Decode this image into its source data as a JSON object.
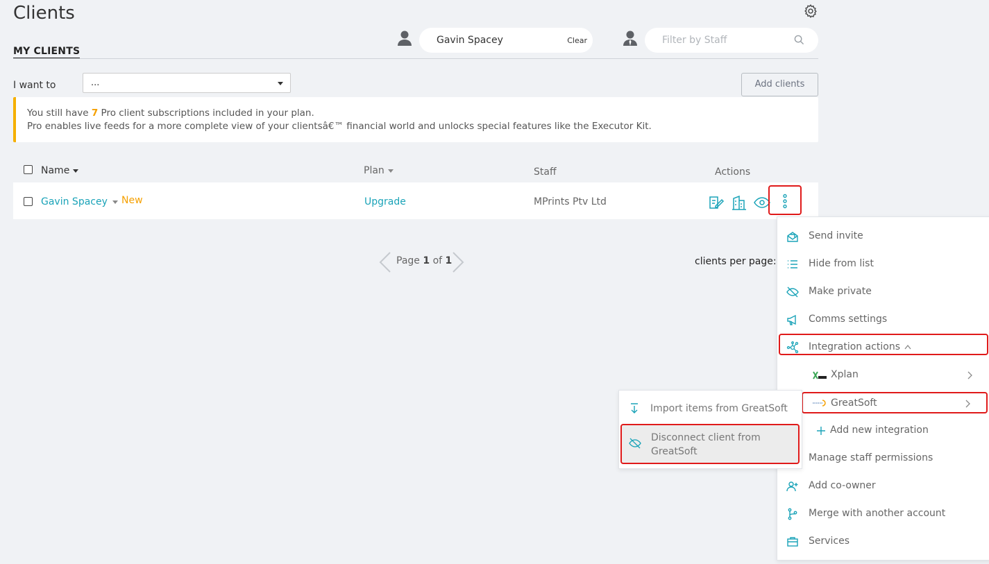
{
  "page": {
    "title": "Clients"
  },
  "tabs": {
    "my_clients": "MY CLIENTS"
  },
  "client_filter": {
    "value": "Gavin Spacey",
    "clear_label": "Clear"
  },
  "staff_filter": {
    "placeholder": "Filter by Staff"
  },
  "toolbar": {
    "i_want_label": "I want to",
    "select_value": "...",
    "add_clients_label": "Add clients"
  },
  "banner": {
    "line1_prefix": "You still have ",
    "line1_count": "7",
    "line1_suffix": " Pro client subscriptions included in your plan.",
    "line2": "Pro enables live feeds for a more complete view of your clientsâ€™ financial world and unlocks special features like the Executor Kit.",
    "accent_color": "#f5b000"
  },
  "table": {
    "headers": {
      "name": "Name",
      "plan": "Plan",
      "staff": "Staff",
      "actions": "Actions"
    },
    "rows": [
      {
        "name": "Gavin Spacey",
        "badge": "New",
        "plan": "Upgrade",
        "staff": "MPrints Ptv Ltd"
      }
    ]
  },
  "pagination": {
    "page_label": "Page",
    "current": "1",
    "of_label": "of",
    "total": "1",
    "per_page_label": "clients per page:"
  },
  "actions_menu": {
    "items": [
      {
        "label": "Send invite",
        "icon": "envelope-open-icon"
      },
      {
        "label": "Hide from list",
        "icon": "list-icon"
      },
      {
        "label": "Make private",
        "icon": "eye-slash-icon"
      },
      {
        "label": "Comms settings",
        "icon": "megaphone-icon"
      },
      {
        "label": "Integration actions",
        "icon": "network-icon"
      },
      {
        "label": "Xplan",
        "icon": "xplan-logo-icon"
      },
      {
        "label": "GreatSoft",
        "icon": "greatsoft-logo-icon"
      },
      {
        "label": "Add new integration",
        "icon": "plus-icon"
      },
      {
        "label": "Manage staff permissions",
        "icon": ""
      },
      {
        "label": "Add co-owner",
        "icon": "user-plus-icon"
      },
      {
        "label": "Merge with another account",
        "icon": "branch-icon"
      },
      {
        "label": "Services",
        "icon": "briefcase-icon"
      }
    ]
  },
  "greatsoft_submenu": {
    "items": [
      {
        "label": "Import items from GreatSoft",
        "icon": "arrow-down-icon"
      },
      {
        "label_line1": "Disconnect client from",
        "label_line2": "GreatSoft",
        "icon": "eye-slash-icon"
      }
    ]
  },
  "colors": {
    "accent": "#1aa3b8",
    "highlight_border": "#e01a1a",
    "badge": "#f5a000"
  }
}
